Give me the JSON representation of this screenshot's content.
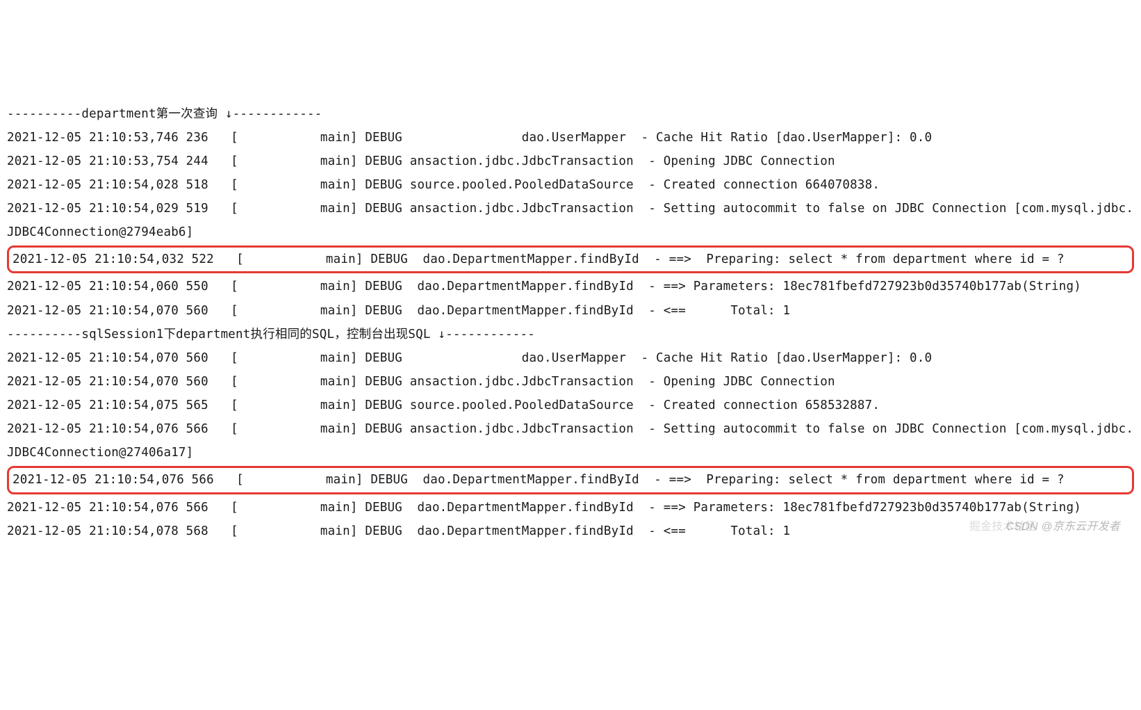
{
  "lines": [
    {
      "text": "----------department第一次查询 ↓------------",
      "highlight": false
    },
    {
      "text": "2021-12-05 21:10:53,746 236   [           main] DEBUG                dao.UserMapper  - Cache Hit Ratio [dao.UserMapper]: 0.0",
      "highlight": false
    },
    {
      "text": "2021-12-05 21:10:53,754 244   [           main] DEBUG ansaction.jdbc.JdbcTransaction  - Opening JDBC Connection",
      "highlight": false
    },
    {
      "text": "2021-12-05 21:10:54,028 518   [           main] DEBUG source.pooled.PooledDataSource  - Created connection 664070838.",
      "highlight": false
    },
    {
      "text": "2021-12-05 21:10:54,029 519   [           main] DEBUG ansaction.jdbc.JdbcTransaction  - Setting autocommit to false on JDBC Connection [com.mysql.jdbc.JDBC4Connection@2794eab6]",
      "highlight": false
    },
    {
      "text": "2021-12-05 21:10:54,032 522   [           main] DEBUG  dao.DepartmentMapper.findById  - ==>  Preparing: select * from department where id = ? ",
      "highlight": true
    },
    {
      "text": "2021-12-05 21:10:54,060 550   [           main] DEBUG  dao.DepartmentMapper.findById  - ==> Parameters: 18ec781fbefd727923b0d35740b177ab(String)",
      "highlight": false
    },
    {
      "text": "2021-12-05 21:10:54,070 560   [           main] DEBUG  dao.DepartmentMapper.findById  - <==      Total: 1",
      "highlight": false
    },
    {
      "text": "----------sqlSession1下department执行相同的SQL，控制台出现SQL ↓------------",
      "highlight": false
    },
    {
      "text": "2021-12-05 21:10:54,070 560   [           main] DEBUG                dao.UserMapper  - Cache Hit Ratio [dao.UserMapper]: 0.0",
      "highlight": false
    },
    {
      "text": "2021-12-05 21:10:54,070 560   [           main] DEBUG ansaction.jdbc.JdbcTransaction  - Opening JDBC Connection",
      "highlight": false
    },
    {
      "text": "2021-12-05 21:10:54,075 565   [           main] DEBUG source.pooled.PooledDataSource  - Created connection 658532887.",
      "highlight": false
    },
    {
      "text": "2021-12-05 21:10:54,076 566   [           main] DEBUG ansaction.jdbc.JdbcTransaction  - Setting autocommit to false on JDBC Connection [com.mysql.jdbc.JDBC4Connection@27406a17]",
      "highlight": false
    },
    {
      "text": "2021-12-05 21:10:54,076 566   [           main] DEBUG  dao.DepartmentMapper.findById  - ==>  Preparing: select * from department where id = ? ",
      "highlight": true
    },
    {
      "text": "2021-12-05 21:10:54,076 566   [           main] DEBUG  dao.DepartmentMapper.findById  - ==> Parameters: 18ec781fbefd727923b0d35740b177ab(String)",
      "highlight": false
    },
    {
      "text": "2021-12-05 21:10:54,078 568   [           main] DEBUG  dao.DepartmentMapper.findById  - <==      Total: 1",
      "highlight": false
    }
  ],
  "watermark1": "CSDN @京东云开发者",
  "watermark2": "掘金技术社区"
}
